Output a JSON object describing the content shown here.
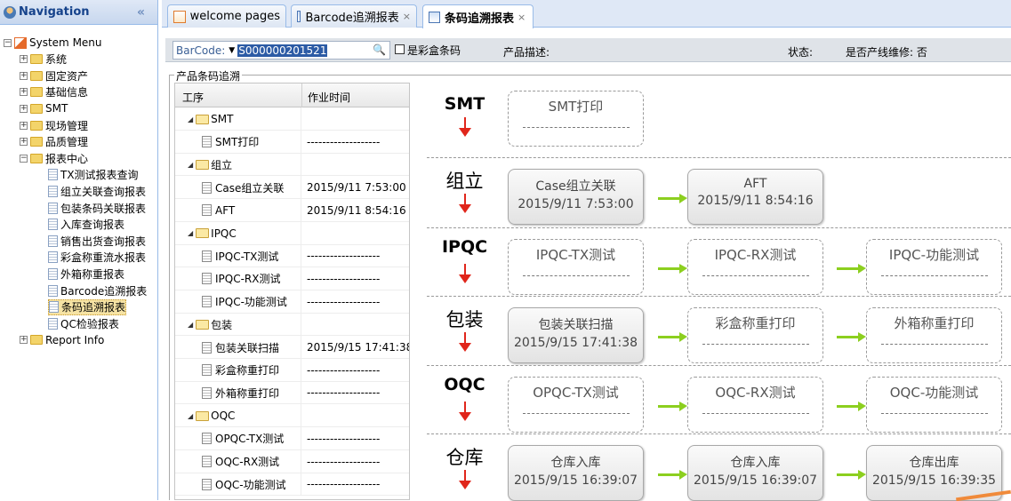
{
  "sidebar": {
    "title": "Navigation",
    "collapse_icon": "«",
    "root": "System Menu",
    "items": [
      "系统",
      "固定资产",
      "基础信息",
      "SMT",
      "现场管理",
      "品质管理",
      "报表中心"
    ],
    "reports": [
      "TX测试报表查询",
      "组立关联查询报表",
      "包装条码关联报表",
      "入库查询报表",
      "销售出货查询报表",
      "彩盒称重流水报表",
      "外箱称重报表",
      "Barcode追溯报表",
      "条码追溯报表",
      "QC检验报表"
    ],
    "last": "Report Info",
    "selected": "条码追溯报表"
  },
  "tabs": [
    {
      "label": "welcome pages",
      "close": ""
    },
    {
      "label": "Barcode追溯报表",
      "close": "×"
    },
    {
      "label": "条码追溯报表",
      "close": "×"
    }
  ],
  "toolbar": {
    "barcode_label": "BarCode:",
    "barcode_value": "S000000201521",
    "checkbox_label": "是彩盒条码",
    "desc_label": "产品描述:",
    "state_label": "状态:",
    "repair_label": "是否产线维修: 否"
  },
  "panel": {
    "legend": "产品条码追溯",
    "col_process": "工序",
    "col_time": "作业时间"
  },
  "grid_rows": [
    {
      "type": "group",
      "name": "SMT",
      "time": ""
    },
    {
      "type": "leaf",
      "name": "SMT打印",
      "time": "-------------------"
    },
    {
      "type": "group",
      "name": "组立",
      "time": ""
    },
    {
      "type": "leaf",
      "name": "Case组立关联",
      "time": "2015/9/11 7:53:00"
    },
    {
      "type": "leaf",
      "name": "AFT",
      "time": "2015/9/11 8:54:16"
    },
    {
      "type": "group",
      "name": "IPQC",
      "time": ""
    },
    {
      "type": "leaf",
      "name": "IPQC-TX测试",
      "time": "-------------------"
    },
    {
      "type": "leaf",
      "name": "IPQC-RX测试",
      "time": "-------------------"
    },
    {
      "type": "leaf",
      "name": "IPQC-功能测试",
      "time": "-------------------"
    },
    {
      "type": "group",
      "name": "包装",
      "time": ""
    },
    {
      "type": "leaf",
      "name": "包装关联扫描",
      "time": "2015/9/15 17:41:38"
    },
    {
      "type": "leaf",
      "name": "彩盒称重打印",
      "time": "-------------------"
    },
    {
      "type": "leaf",
      "name": "外箱称重打印",
      "time": "-------------------"
    },
    {
      "type": "group",
      "name": "OQC",
      "time": ""
    },
    {
      "type": "leaf",
      "name": "OPQC-TX测试",
      "time": "-------------------"
    },
    {
      "type": "leaf",
      "name": "OQC-RX测试",
      "time": "-------------------"
    },
    {
      "type": "leaf",
      "name": "OQC-功能测试",
      "time": "-------------------"
    }
  ],
  "lanes": [
    {
      "stage": "SMT",
      "steps": [
        {
          "name": "SMT打印",
          "time": "",
          "done": false
        }
      ]
    },
    {
      "stage": "组立",
      "steps": [
        {
          "name": "Case组立关联",
          "time": "2015/9/11 7:53:00",
          "done": true
        },
        {
          "name": "AFT",
          "time": "2015/9/11 8:54:16",
          "done": true
        }
      ]
    },
    {
      "stage": "IPQC",
      "steps": [
        {
          "name": "IPQC-TX测试",
          "time": "",
          "done": false
        },
        {
          "name": "IPQC-RX测试",
          "time": "",
          "done": false
        },
        {
          "name": "IPQC-功能测试",
          "time": "",
          "done": false
        }
      ]
    },
    {
      "stage": "包装",
      "steps": [
        {
          "name": "包装关联扫描",
          "time": "2015/9/15 17:41:38",
          "done": true
        },
        {
          "name": "彩盒称重打印",
          "time": "",
          "done": false
        },
        {
          "name": "外箱称重打印",
          "time": "",
          "done": false
        }
      ]
    },
    {
      "stage": "OQC",
      "steps": [
        {
          "name": "OPQC-TX测试",
          "time": "",
          "done": false
        },
        {
          "name": "OQC-RX测试",
          "time": "",
          "done": false
        },
        {
          "name": "OQC-功能测试",
          "time": "",
          "done": false
        }
      ]
    },
    {
      "stage": "仓库",
      "steps": [
        {
          "name": "仓库入库",
          "time": "2015/9/15 16:39:07",
          "done": true
        },
        {
          "name": "仓库入库",
          "time": "2015/9/15 16:39:07",
          "done": true
        },
        {
          "name": "仓库出库",
          "time": "2015/9/15 16:39:35",
          "done": true
        }
      ]
    }
  ]
}
